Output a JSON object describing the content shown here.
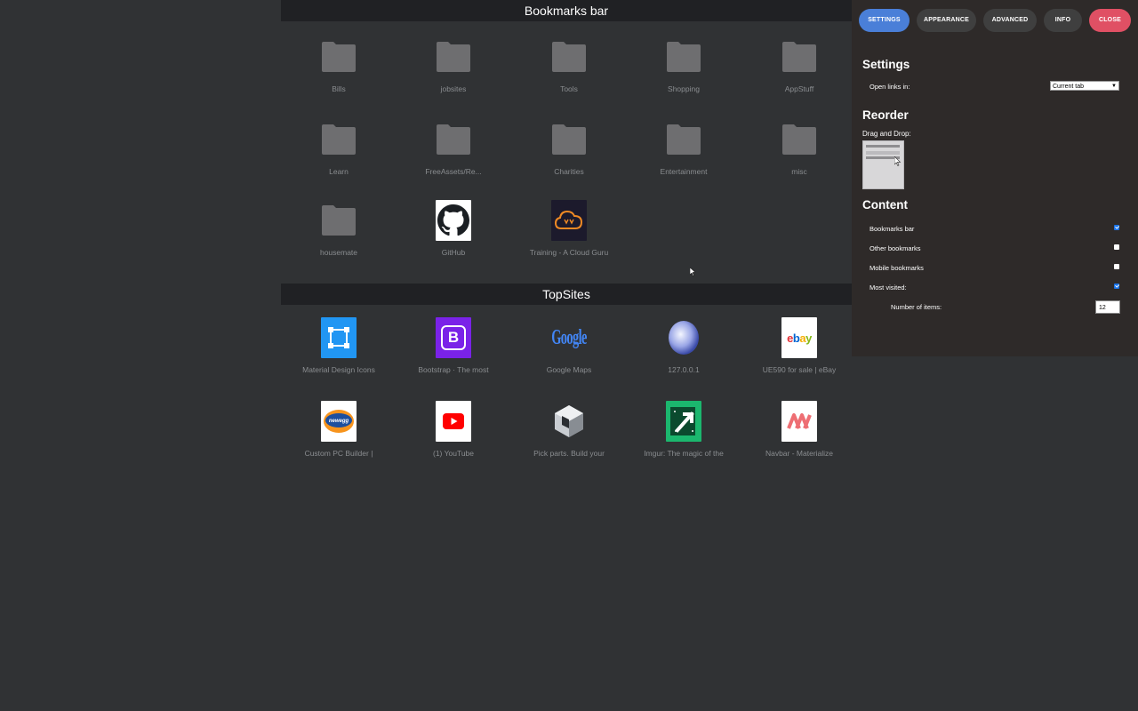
{
  "bookmarks": {
    "title": "Bookmarks bar",
    "items": [
      {
        "label": "Bills",
        "icon": "folder-icon"
      },
      {
        "label": "jobsites",
        "icon": "folder-icon"
      },
      {
        "label": "Tools",
        "icon": "folder-icon"
      },
      {
        "label": "Shopping",
        "icon": "folder-icon"
      },
      {
        "label": "AppStuff",
        "icon": "folder-icon"
      },
      {
        "label": "Learn",
        "icon": "folder-icon"
      },
      {
        "label": "FreeAssets/Re...",
        "icon": "folder-icon"
      },
      {
        "label": "Charities",
        "icon": "folder-icon"
      },
      {
        "label": "Entertainment",
        "icon": "folder-icon"
      },
      {
        "label": "misc",
        "icon": "folder-icon"
      },
      {
        "label": "housemate",
        "icon": "folder-icon"
      },
      {
        "label": "GitHub",
        "icon": "github-icon"
      },
      {
        "label": "Training - A Cloud Guru",
        "icon": "acloudguru-icon"
      }
    ]
  },
  "topsites": {
    "title": "TopSites",
    "items": [
      {
        "label": "Material Design Icons",
        "icon": "material-design-icon"
      },
      {
        "label": "Bootstrap · The most popular",
        "icon": "bootstrap-icon",
        "logo_text": "B"
      },
      {
        "label": "Google Maps",
        "icon": "google-icon",
        "logo_text": "Google"
      },
      {
        "label": "127.0.0.1",
        "icon": "globe-icon"
      },
      {
        "label": "UE590 for sale | eBay",
        "icon": "ebay-icon",
        "logo_text": "ebay"
      },
      {
        "label": "Custom PC Builder | Newegg",
        "icon": "newegg-icon",
        "logo_text": "newegg"
      },
      {
        "label": "(1) YouTube",
        "icon": "youtube-icon"
      },
      {
        "label": "Pick parts. Build your PC",
        "icon": "pcpartpicker-icon"
      },
      {
        "label": "Imgur: The magic of the Internet",
        "icon": "imgur-icon"
      },
      {
        "label": "Navbar - Materialize",
        "icon": "materialize-icon"
      }
    ]
  },
  "panel": {
    "tabs": [
      {
        "label": "SETTINGS",
        "color": "#4a7fd8"
      },
      {
        "label": "APPEARANCE",
        "color": "#3f3f3f"
      },
      {
        "label": "ADVANCED",
        "color": "#3f3f3f"
      },
      {
        "label": "INFO",
        "color": "#3f3f3f"
      },
      {
        "label": "CLOSE",
        "color": "#e05064"
      }
    ],
    "settings_heading": "Settings",
    "open_links_label": "Open links in:",
    "open_links_value": "Current tab",
    "reorder_heading": "Reorder",
    "drag_drop_label": "Drag and Drop:",
    "content_heading": "Content",
    "content_options": [
      {
        "label": "Bookmarks bar",
        "checked": true
      },
      {
        "label": "Other bookmarks",
        "checked": false
      },
      {
        "label": "Mobile bookmarks",
        "checked": false
      },
      {
        "label": "Most visited:",
        "checked": true
      }
    ],
    "num_items_label": "Number of items:",
    "num_items_value": "12"
  },
  "colors": {
    "background": "#303234",
    "header": "#202124",
    "panel": "#2e2a29",
    "folder": "#6e6e70",
    "accent": "#4a7fd8",
    "close": "#e05064"
  }
}
